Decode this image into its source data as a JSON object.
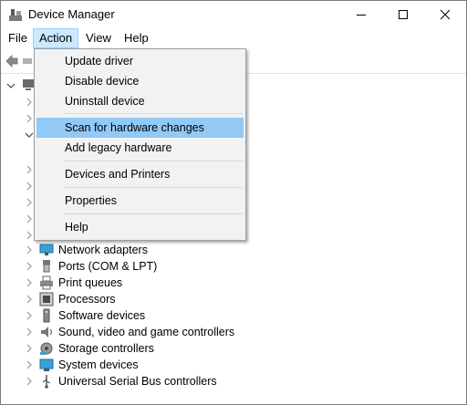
{
  "window": {
    "title": "Device Manager"
  },
  "menubar": {
    "file": "File",
    "action": "Action",
    "view": "View",
    "help": "Help"
  },
  "action_menu": {
    "update_driver": "Update driver",
    "disable_device": "Disable device",
    "uninstall_device": "Uninstall device",
    "scan": "Scan for hardware changes",
    "add_legacy": "Add legacy hardware",
    "devices_printers": "Devices and Printers",
    "properties": "Properties",
    "help": "Help"
  },
  "tree": {
    "network_adapters": "Network adapters",
    "ports": "Ports (COM & LPT)",
    "print_queues": "Print queues",
    "processors": "Processors",
    "software_devices": "Software devices",
    "sound": "Sound, video and game controllers",
    "storage": "Storage controllers",
    "system_devices": "System devices",
    "usb": "Universal Serial Bus controllers"
  },
  "colors": {
    "menu_active_bg": "#cce8ff",
    "menu_hover": "#91c9f7",
    "menu_bg": "#f2f2f2"
  }
}
